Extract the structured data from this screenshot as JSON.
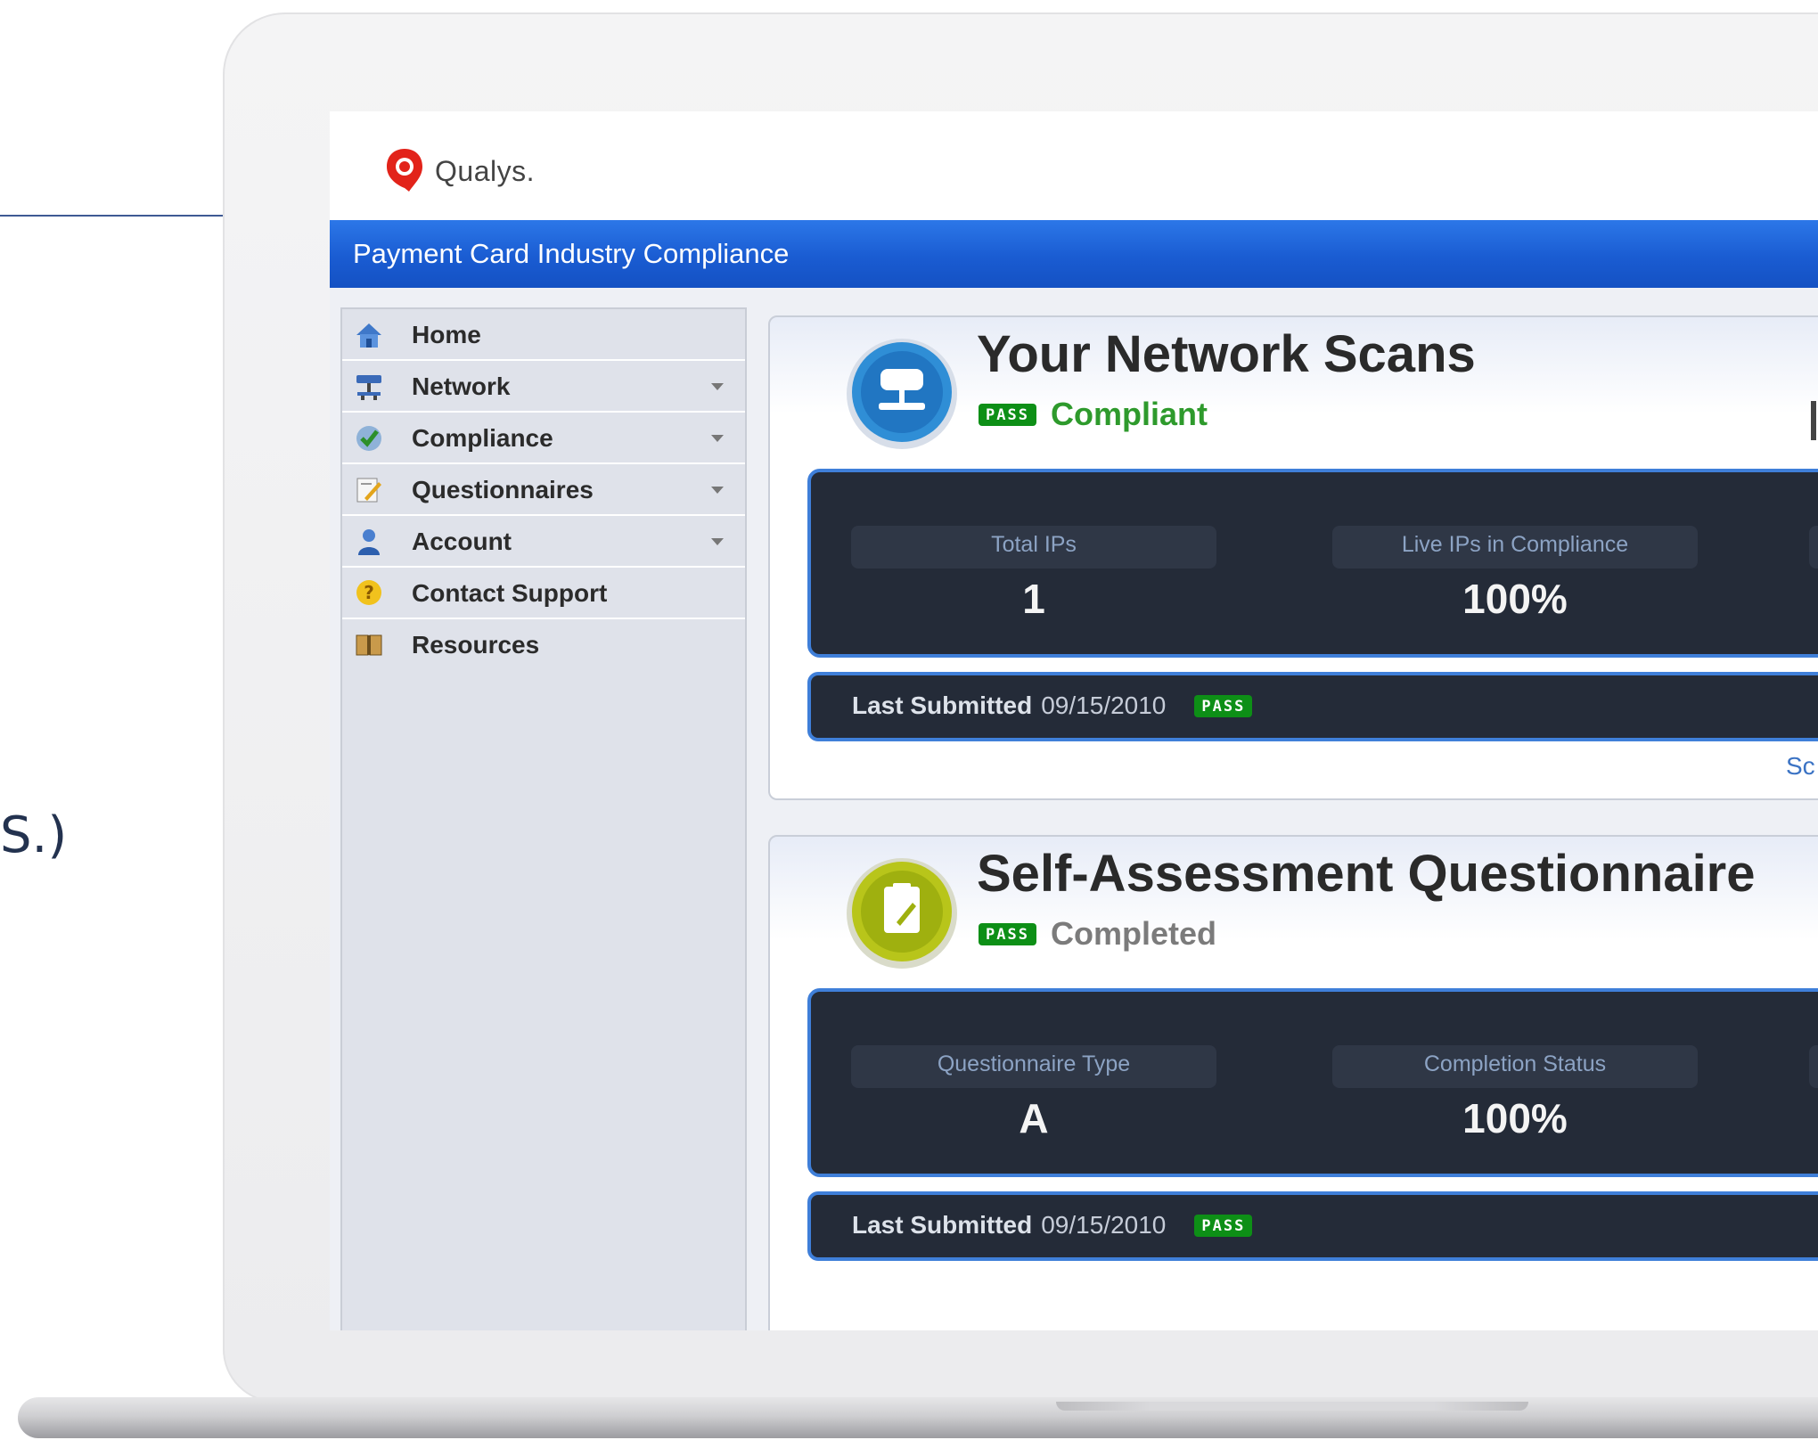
{
  "background": {
    "fragment_text": "S.)"
  },
  "app": {
    "brand": "Qualys.",
    "title": "Payment Card Industry Compliance"
  },
  "sidebar": {
    "items": [
      {
        "label": "Home",
        "icon": "home-icon",
        "has_submenu": false
      },
      {
        "label": "Network",
        "icon": "network-icon",
        "has_submenu": true
      },
      {
        "label": "Compliance",
        "icon": "compliance-check-icon",
        "has_submenu": true
      },
      {
        "label": "Questionnaires",
        "icon": "questionnaire-edit-icon",
        "has_submenu": true
      },
      {
        "label": "Account",
        "icon": "user-icon",
        "has_submenu": true
      },
      {
        "label": "Contact Support",
        "icon": "support-question-icon",
        "has_submenu": false
      },
      {
        "label": "Resources",
        "icon": "book-icon",
        "has_submenu": false
      }
    ]
  },
  "cards": {
    "network_scans": {
      "title": "Your Network Scans",
      "badge": "PASS",
      "status": "Compliant",
      "stats": [
        {
          "label": "Total IPs",
          "value": "1"
        },
        {
          "label": "Live IPs in Compliance",
          "value": "100%"
        }
      ],
      "last_submitted_label": "Last Submitted",
      "last_submitted_date": "09/15/2010",
      "last_submitted_badge": "PASS",
      "link_fragment": "Sc"
    },
    "questionnaire": {
      "title": "Self-Assessment Questionnaire",
      "badge": "PASS",
      "status": "Completed",
      "stats": [
        {
          "label": "Questionnaire Type",
          "value": "A"
        },
        {
          "label": "Completion Status",
          "value": "100%"
        }
      ],
      "last_submitted_label": "Last Submitted",
      "last_submitted_date": "09/15/2010",
      "last_submitted_badge": "PASS"
    }
  },
  "colors": {
    "titlebar_blue": "#1a5cd2",
    "pass_green": "#0d8f16",
    "compliant_green": "#2e9a2c",
    "panel_dark": "#242b38",
    "panel_border": "#3f7fd9"
  }
}
